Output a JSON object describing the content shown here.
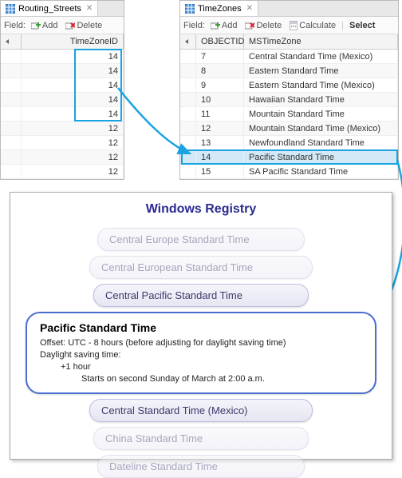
{
  "left_table": {
    "tab_label": "Routing_Streets",
    "field_label": "Field:",
    "btn_add": "Add",
    "btn_delete": "Delete",
    "column": "TimeZoneID",
    "rows": [
      "14",
      "14",
      "14",
      "14",
      "14",
      "12",
      "12",
      "12",
      "12"
    ],
    "highlight_start": 0,
    "highlight_end": 4
  },
  "right_table": {
    "tab_label": "TimeZones",
    "field_label": "Field:",
    "btn_add": "Add",
    "btn_delete": "Delete",
    "btn_calc": "Calculate",
    "btn_select": "Select",
    "col1": "OBJECTID",
    "col2": "MSTimeZone",
    "rows": [
      {
        "id": "7",
        "tz": "Central Standard Time (Mexico)"
      },
      {
        "id": "8",
        "tz": "Eastern Standard Time"
      },
      {
        "id": "9",
        "tz": "Eastern Standard Time (Mexico)"
      },
      {
        "id": "10",
        "tz": "Hawaiian Standard Time"
      },
      {
        "id": "11",
        "tz": "Mountain Standard Time"
      },
      {
        "id": "12",
        "tz": "Mountain Standard Time (Mexico)"
      },
      {
        "id": "13",
        "tz": "Newfoundland Standard Time"
      },
      {
        "id": "14",
        "tz": "Pacific Standard Time"
      },
      {
        "id": "15",
        "tz": "SA Pacific Standard Time"
      }
    ],
    "highlight_index": 7
  },
  "registry": {
    "title": "Windows Registry",
    "items_before": [
      "Central Europe Standard Time",
      "Central European Standard Time",
      "Central Pacific Standard Time"
    ],
    "expanded": {
      "name": "Pacific Standard Time",
      "offset_line": "Offset: UTC - 8 hours (before adjusting for daylight saving time)",
      "dst_label": "Daylight saving time:",
      "dst_offset": "+1 hour",
      "dst_start": "Starts on second Sunday of March at 2:00 a.m."
    },
    "items_after": [
      "Central Standard Time (Mexico)",
      "China Standard Time",
      "Dateline Standard Time"
    ]
  },
  "icons": {
    "table": "table-icon",
    "add": "add-icon",
    "delete": "delete-icon",
    "calc": "calculator-icon"
  }
}
